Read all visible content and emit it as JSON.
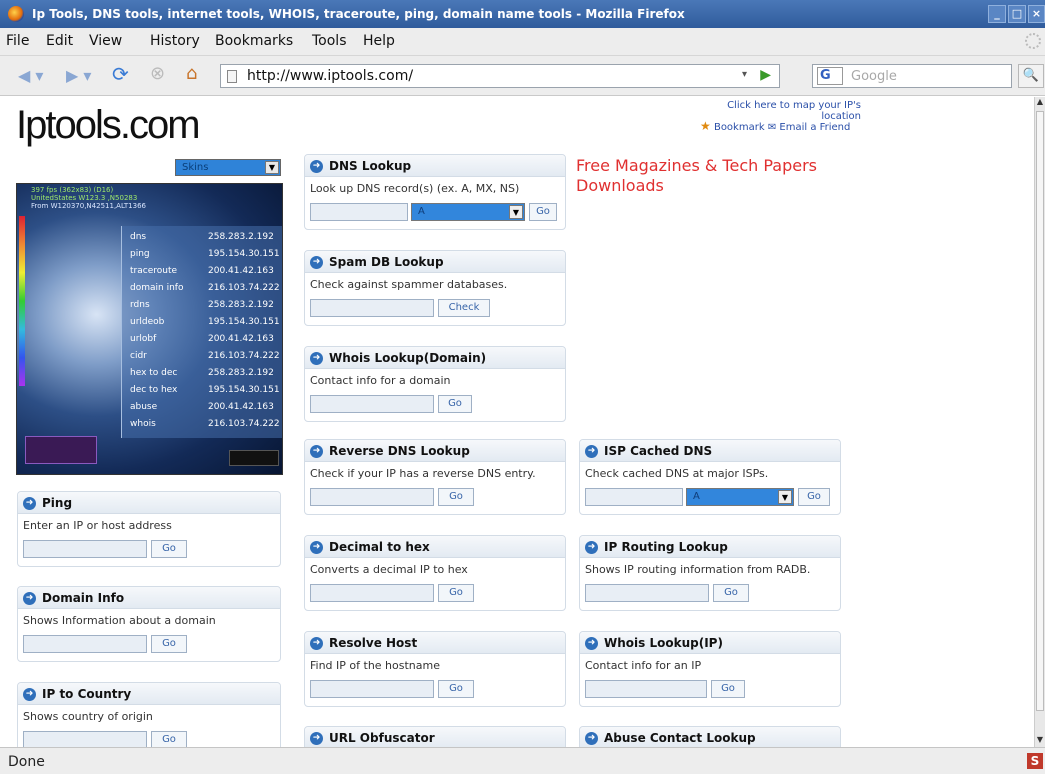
{
  "window": {
    "title": "Ip Tools, DNS tools, internet tools, WHOIS, traceroute, ping, domain name tools - Mozilla Firefox"
  },
  "menu": [
    "File",
    "Edit",
    "View",
    "History",
    "Bookmarks",
    "Tools",
    "Help"
  ],
  "address": {
    "url": "http://www.iptools.com/"
  },
  "search": {
    "placeholder": "Google",
    "engine": "G"
  },
  "status": {
    "text": "Done"
  },
  "page": {
    "logo": "Iptools.com",
    "map_link": "Click here to map your IP's location",
    "bookmark": "Bookmark",
    "email_friend": "Email a Friend",
    "skins_label": "Skins",
    "ad_line1": "Free Magazines & Tech Papers",
    "ad_line2": "Downloads"
  },
  "globe": {
    "stats_line1": "397 fps (362x83) (D16)",
    "stats_line2": "UnitedStates W123.3 ,N50283",
    "stats_line3": "From W120370,N42511,ALT1366",
    "rows": [
      {
        "k": "dns",
        "v": "258.283.2.192"
      },
      {
        "k": "ping",
        "v": "195.154.30.151"
      },
      {
        "k": "traceroute",
        "v": "200.41.42.163"
      },
      {
        "k": "domain info",
        "v": "216.103.74.222"
      },
      {
        "k": "rdns",
        "v": "258.283.2.192"
      },
      {
        "k": "urldeob",
        "v": "195.154.30.151"
      },
      {
        "k": "urlobf",
        "v": "200.41.42.163"
      },
      {
        "k": "cidr",
        "v": "216.103.74.222"
      },
      {
        "k": "hex to dec",
        "v": "258.283.2.192"
      },
      {
        "k": "dec to hex",
        "v": "195.154.30.151"
      },
      {
        "k": "abuse",
        "v": "200.41.42.163"
      },
      {
        "k": "whois",
        "v": "216.103.74.222"
      }
    ]
  },
  "tools": {
    "ping": {
      "title": "Ping",
      "desc": "Enter an IP or host address",
      "btn": "Go"
    },
    "domain_info": {
      "title": "Domain Info",
      "desc": "Shows Information about a domain",
      "btn": "Go"
    },
    "ip_country": {
      "title": "IP to Country",
      "desc": "Shows country of origin",
      "btn": "Go"
    },
    "dns": {
      "title": "DNS Lookup",
      "desc": "Look up DNS record(s) (ex. A, MX, NS)",
      "select": "A",
      "btn": "Go"
    },
    "spam": {
      "title": "Spam DB Lookup",
      "desc": "Check against spammer databases.",
      "btn": "Check"
    },
    "whois_domain": {
      "title": "Whois Lookup(Domain)",
      "desc": "Contact info for a domain",
      "btn": "Go"
    },
    "rdns": {
      "title": "Reverse DNS Lookup",
      "desc": "Check if your IP has a reverse DNS entry.",
      "btn": "Go"
    },
    "dec_hex": {
      "title": "Decimal to hex",
      "desc": "Converts a decimal IP to hex",
      "btn": "Go"
    },
    "resolve": {
      "title": "Resolve Host",
      "desc": "Find IP of the hostname",
      "btn": "Go"
    },
    "url_obf": {
      "title": "URL Obfuscator"
    },
    "isp_dns": {
      "title": "ISP Cached DNS",
      "desc": "Check cached DNS at major ISPs.",
      "select": "A",
      "btn": "Go"
    },
    "ip_routing": {
      "title": "IP Routing Lookup",
      "desc": "Shows IP routing information from RADB.",
      "btn": "Go"
    },
    "whois_ip": {
      "title": "Whois Lookup(IP)",
      "desc": "Contact info for an IP",
      "btn": "Go"
    },
    "abuse": {
      "title": "Abuse Contact Lookup"
    }
  }
}
